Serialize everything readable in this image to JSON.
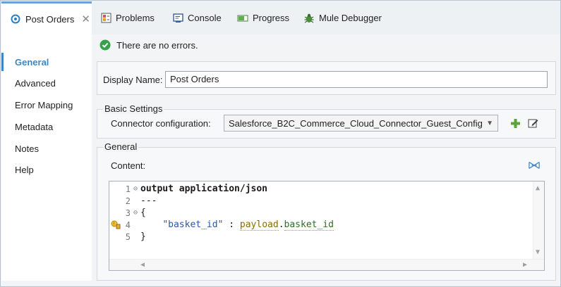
{
  "tabs": {
    "active": {
      "label": "Post Orders",
      "icon": "connector-icon"
    },
    "others": [
      {
        "label": "Problems",
        "icon": "problems-icon"
      },
      {
        "label": "Console",
        "icon": "console-icon"
      },
      {
        "label": "Progress",
        "icon": "progress-icon"
      },
      {
        "label": "Mule Debugger",
        "icon": "debugger-icon"
      }
    ]
  },
  "nav": {
    "items": [
      {
        "label": "General",
        "active": true
      },
      {
        "label": "Advanced"
      },
      {
        "label": "Error Mapping"
      },
      {
        "label": "Metadata"
      },
      {
        "label": "Notes"
      },
      {
        "label": "Help"
      }
    ]
  },
  "status": {
    "text": "There are no errors."
  },
  "display": {
    "label": "Display Name:",
    "value": "Post Orders"
  },
  "basic": {
    "title": "Basic Settings",
    "connector_label": "Connector configuration:",
    "connector_value": "Salesforce_B2C_Commerce_Cloud_Connector_Guest_Config"
  },
  "general": {
    "title": "General",
    "content_label": "Content:"
  },
  "editor": {
    "lines": [
      {
        "n": "1",
        "fold": "⊖",
        "text": "output application/json"
      },
      {
        "n": "2",
        "fold": "",
        "text": "---"
      },
      {
        "n": "3",
        "fold": "⊖",
        "text": "{"
      },
      {
        "n": "4",
        "fold": "",
        "key": "\"basket_id\"",
        "sep": " : ",
        "var": "payload",
        "dot": ".",
        "field": "basket_id"
      },
      {
        "n": "5",
        "fold": "",
        "text": "}"
      }
    ]
  },
  "colors": {
    "accent": "#3d86c6",
    "ok": "#3aa14b"
  }
}
